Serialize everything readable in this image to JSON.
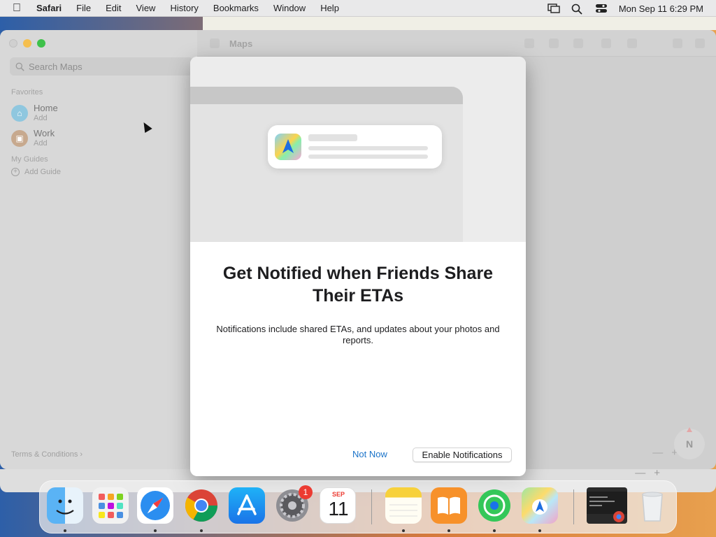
{
  "menubar": {
    "app_name": "Safari",
    "items": [
      "File",
      "Edit",
      "View",
      "History",
      "Bookmarks",
      "Window",
      "Help"
    ],
    "datetime": "Mon Sep 11  6:29 PM"
  },
  "maps": {
    "title": "Maps",
    "search_placeholder": "Search Maps",
    "favorites_label": "Favorites",
    "favorites": [
      {
        "name": "Home",
        "sub": "Add"
      },
      {
        "name": "Work",
        "sub": "Add"
      }
    ],
    "guides_label": "My Guides",
    "add_guide": "Add Guide",
    "terms": "Terms & Conditions ›",
    "compass": "N"
  },
  "modal": {
    "title": "Get Notified when Friends Share Their ETAs",
    "description": "Notifications include shared ETAs, and updates about your photos and reports.",
    "not_now": "Not Now",
    "enable": "Enable Notifications"
  },
  "dock": {
    "notification_badge": "1",
    "calendar_month": "SEP",
    "calendar_day": "11"
  },
  "colors": {
    "link": "#1a73c9",
    "badge": "#ec3b32"
  }
}
